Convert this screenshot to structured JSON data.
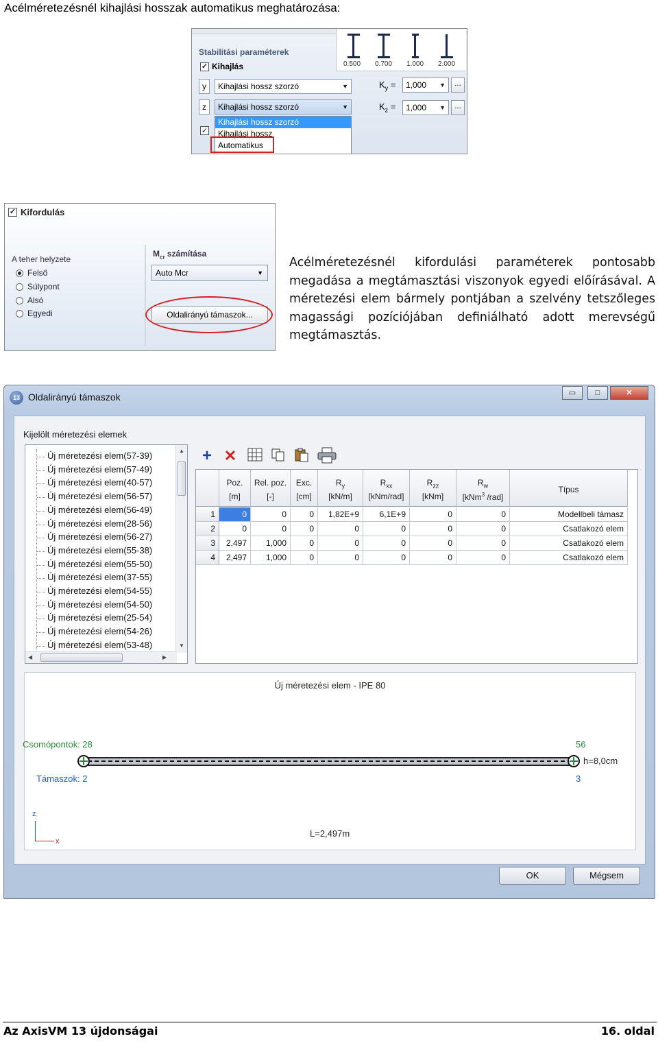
{
  "heading": "Acélméretezésnél kihajlási hosszak automatikus meghatározása:",
  "stab": {
    "title": "Stabilitási paraméterek",
    "kihajlas_label": "Kihajlás",
    "axis_y": "y",
    "axis_z": "z",
    "combo_y": "Kihajlási hossz szorzó",
    "combo_z": "Kihajlási hossz szorzó",
    "ky_label": "K",
    "ky_sub": "y",
    "kz_label": "K",
    "kz_sub": "z",
    "eq": "=",
    "ky_value": "1,000",
    "kz_value": "1,000",
    "dots": "...",
    "dropdown_options": [
      "Kihajlási hossz szorzó",
      "Kihajlási hossz",
      "Automatikus"
    ],
    "beam_labels": [
      "0.500",
      "0.700",
      "1.000",
      "2.000"
    ]
  },
  "kif": {
    "title": "Kifordulás",
    "group_label": "A teher helyzete",
    "options": [
      "Felső",
      "Súlypont",
      "Alsó",
      "Egyedi"
    ],
    "selected_option": "Felső",
    "mcr_label": "M",
    "mcr_sub": "cr",
    "mcr_rest": " számítása",
    "mcr_combo": "Auto Mcr",
    "support_button": "Oldalirányú támaszok..."
  },
  "paragraph": "Acélméretezésnél kifordulási paraméterek pontosabb megadása a megtámasztási viszonyok egyedi előírásával. A méretezési elem bármely pontjában a szelvény tetszőleges magassági pozíciójában definiálható adott merevségű megtámasztás.",
  "dialog": {
    "app_icon_text": "13",
    "title": "Oldalirányú támaszok",
    "minimize": "▭",
    "maximize": "□",
    "close": "✕",
    "group_label": "Kijelölt méretezési elemek",
    "tree_items": [
      "Új méretezési elem(57-39)",
      "Új méretezési elem(57-49)",
      "Új méretezési elem(40-57)",
      "Új méretezési elem(56-57)",
      "Új méretezési elem(56-49)",
      "Új méretezési elem(28-56)",
      "Új méretezési elem(56-27)",
      "Új méretezési elem(55-38)",
      "Új méretezési elem(55-50)",
      "Új méretezési elem(37-55)",
      "Új méretezési elem(54-55)",
      "Új méretezési elem(54-50)",
      "Új méretezési elem(25-54)",
      "Új méretezési elem(54-26)",
      "Új méretezési elem(53-48)"
    ],
    "toolbar_icons": [
      "add-icon",
      "delete-icon",
      "columns-icon",
      "copy-icon",
      "paste-icon",
      "print-icon"
    ],
    "columns": [
      {
        "l1": "Poz.",
        "l2": "[m]"
      },
      {
        "l1": "Rel. poz.",
        "l2": "[-]"
      },
      {
        "l1": "Exc.",
        "l2": "[cm]"
      },
      {
        "l1": "R",
        "sub": "y",
        "l2": "[kN/m]"
      },
      {
        "l1": "R",
        "sub": "xx",
        "l2": "[kNm/rad]"
      },
      {
        "l1": "R",
        "sub": "zz",
        "l2": "[kNm]"
      },
      {
        "l1": "R",
        "sub": "w",
        "l2a": "[kNm",
        "sup": "3",
        "l2b": " /rad]"
      },
      {
        "l1": "Típus",
        "l2": ""
      }
    ],
    "rows": [
      {
        "n": "1",
        "cells": [
          "0",
          "0",
          "0",
          "1,82E+9",
          "6,1E+9",
          "0",
          "0",
          "Modellbeli támasz"
        ]
      },
      {
        "n": "2",
        "cells": [
          "0",
          "0",
          "0",
          "0",
          "0",
          "0",
          "0",
          "Csatlakozó elem"
        ]
      },
      {
        "n": "3",
        "cells": [
          "2,497",
          "1,000",
          "0",
          "0",
          "0",
          "0",
          "0",
          "Csatlakozó elem"
        ]
      },
      {
        "n": "4",
        "cells": [
          "2,497",
          "1,000",
          "0",
          "0",
          "0",
          "0",
          "0",
          "Csatlakozó elem"
        ]
      }
    ],
    "preview": {
      "title": "Új méretezési elem - IPE  80",
      "nodes_label": "Csomópontok: 28",
      "node_end": "56",
      "supports_label": "Támaszok: ",
      "supports_start": "2",
      "supports_end": "3",
      "height": "h=8,0cm",
      "length": "L=2,497m",
      "axis_z": "z",
      "axis_x": "x"
    },
    "ok": "OK",
    "cancel": "Mégsem"
  },
  "footer": {
    "left": "Az AxisVM 13 újdonságai",
    "right": "16. oldal"
  }
}
